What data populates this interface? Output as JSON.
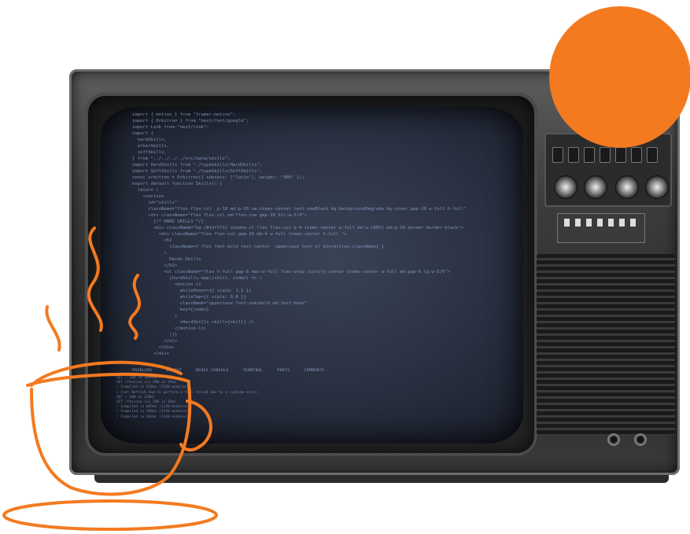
{
  "colors": {
    "accent": "#f47a20",
    "screen": "#2b3244",
    "code_text": "#8fa3c7"
  },
  "code_lines": [
    "import { motion } from \"framer-motion\";",
    "import { Orbitron } from \"next/font/google\";",
    "import Link from \"next/link\";",
    "import {",
    "  hardSkills,",
    "  otherSkills,",
    "  softSkills,",
    "} from \"../../../../src/data/skills\";",
    "import HardSkills from \"./typeSkills/HardSkills\";",
    "import SoftSkills from \"./typeSkills/SoftSkills\";",
    "const orbitron = Orbitron({ subsets: [\"latin\"], weight: \"400\" });",
    "export default function Skills() {",
    "  return (",
    "    <section",
    "      id=\"skills\"",
    "      className=\"flex flex-col  p-10 md:p-20 sm:items-center text-newBlack bg-backgroundDegrade bg-cover gap-10 w-full h-full\"",
    "",
    "      <div className=\"flex flex-col md:flex-row gap-10 2xl:w-3/4\">",
    "        {/* HARD SKILLS */}",
    "        <div className=\"bg-[#faf7f1] shadow-xl flex flex-col p-4 items-center w-full md:w-[60%] md:p-10 border border-black\">",
    "          <div className=\"flex flex-col gap-10 mb-4 w-full items-center h-full \">",
    "            <h2",
    "              className={`flex font-bold text-center  uppercase text-xl ${orbitron.className}`}",
    "            >",
    "              Hards Skills",
    "            </h2>",
    "            <ul className=\"flex h-full gap-6 max-w-full flex-wrap justify-center items-center w-full md:gap-6 lg:w-5/6\">",
    "              {hardSkills.map((skill, index) => (",
    "                <motion.li",
    "                  whileHover={{ scale: 1.2 }}",
    "                  whileTap={{ scale: 0.8 }}",
    "                  className=\"uppercase font-semibold md:text-base\"",
    "",
    "                  key={index}",
    "                >",
    "                  <HardSkills skill={skill} />",
    "                </motion.li>",
    "              ))}",
    "            </ul>",
    "          </div>",
    "        </div>"
  ],
  "terminal_tabs": [
    "PROBLEMS",
    "OUTPUT",
    "DEBUG CONSOLE",
    "TERMINAL",
    "PORTS",
    "COMMENTS"
  ],
  "terminal_lines": [
    "GET / 200 in 1000ms",
    "GET /favicon.ico 200 in 25ms",
    "✓ Compiled in 616ms (1130 modules)",
    "⚠ Fast Refresh had to perform a full reload due to a runtime error.",
    "GET / 200 in 228ms",
    "GET /favicon.ico 200 in 16ms",
    "✓ Compiled in 665ms (1130 modules)",
    "✓ Compiled in 196ms (1130 modules)",
    "✓ Compiled in 202ms (1130 modules)"
  ]
}
